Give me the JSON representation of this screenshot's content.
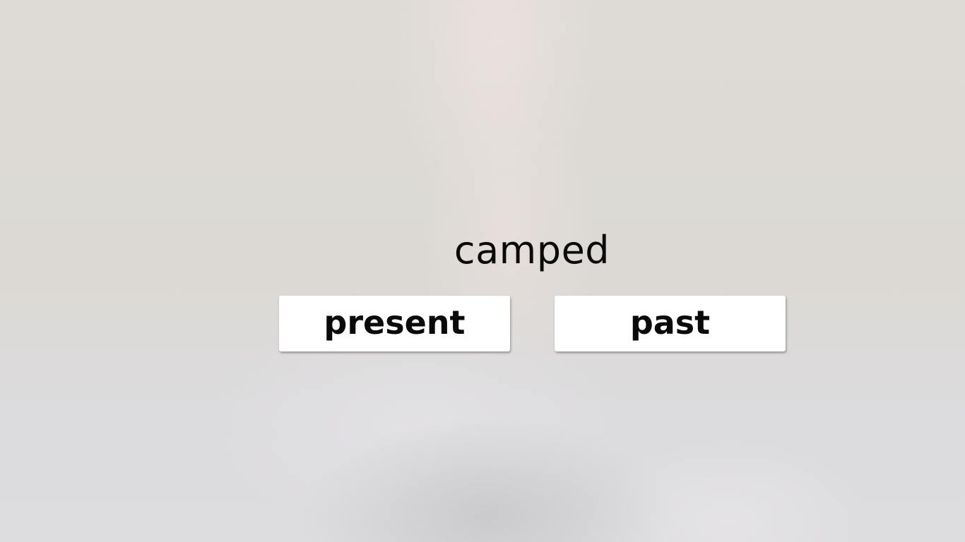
{
  "prompt": {
    "word": "camped"
  },
  "choices": {
    "option_1_label": "present",
    "option_2_label": "past"
  },
  "colors": {
    "background": "#dcd9d4",
    "button_bg": "#ffffff",
    "text": "#0a0a0a"
  }
}
